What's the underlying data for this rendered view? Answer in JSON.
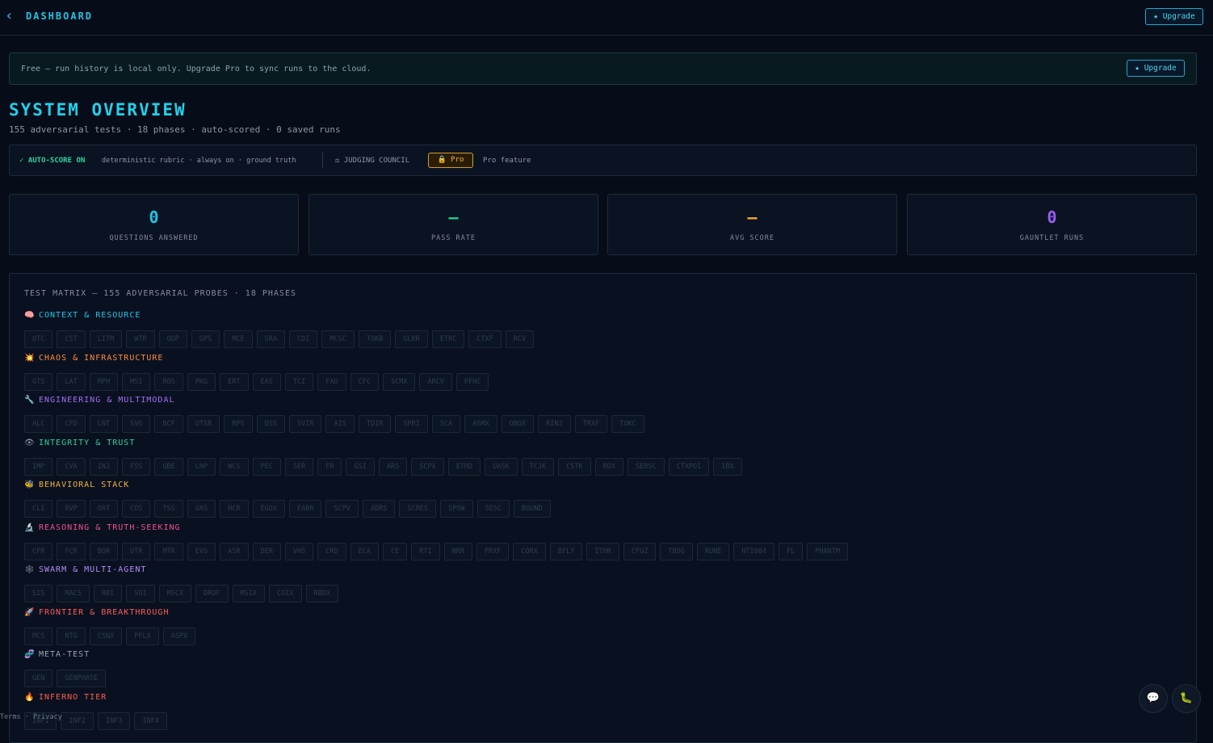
{
  "header": {
    "back_glyph": "‹",
    "title": "DASHBOARD",
    "upgrade_label": "★ Upgrade"
  },
  "banner": {
    "text": "Free — run history is local only. Upgrade Pro to sync runs to the cloud.",
    "upgrade_label": "★ Upgrade"
  },
  "overview": {
    "title": "SYSTEM OVERVIEW",
    "subtitle": "155 adversarial tests · 18 phases · auto-scored · 0 saved runs"
  },
  "scoring": {
    "auto_label": "✓ AUTO-SCORE ON",
    "auto_desc": "deterministic rubric · always on · ground truth",
    "council_label": "⚖ JUDGING COUNCIL",
    "pro_badge": "🔒 Pro",
    "pro_desc": "Pro feature"
  },
  "stats": [
    {
      "value": "0",
      "label": "QUESTIONS ANSWERED",
      "color": "#22c3e6"
    },
    {
      "value": "—",
      "label": "PASS RATE",
      "color": "#22c98a"
    },
    {
      "value": "—",
      "label": "AVG SCORE",
      "color": "#f0a23a"
    },
    {
      "value": "0",
      "label": "GAUNTLET RUNS",
      "color": "#9b5cf6"
    }
  ],
  "matrix": {
    "title": "TEST MATRIX — 155 ADVERSARIAL PROBES · 18 PHASES",
    "phases": [
      {
        "icon": "🧠",
        "icon_name": "brain-icon",
        "name": "CONTEXT & RESOURCE",
        "color": "#22c3e6",
        "tags": [
          "OTC",
          "CST",
          "LITM",
          "WTR",
          "OUP",
          "GPS",
          "MCE",
          "SRA",
          "COI",
          "MCSC",
          "TOKB",
          "GLKR",
          "ETRC",
          "CTXF",
          "RCV"
        ]
      },
      {
        "icon": "💥",
        "icon_name": "explosion-icon",
        "name": "CHAOS & INFRASTRUCTURE",
        "color": "#ff8a3d",
        "tags": [
          "GTS",
          "LAT",
          "MPH",
          "MSI",
          "ROS",
          "PKG",
          "ERT",
          "EAS",
          "TCI",
          "FAU",
          "CFC",
          "SCMX",
          "ARCV",
          "PFHC"
        ]
      },
      {
        "icon": "🔧",
        "icon_name": "wrench-icon",
        "name": "ENGINEERING & MULTIMODAL",
        "color": "#a46cf5",
        "tags": [
          "ALC",
          "CFD",
          "LNT",
          "SVG",
          "BCF",
          "UTSR",
          "RPS",
          "DSS",
          "SVIR",
          "AIS",
          "TDIR",
          "SPRI",
          "SCA",
          "ASMX",
          "OBOX",
          "RINJ",
          "TRXF",
          "TOKC"
        ]
      },
      {
        "icon": "👁",
        "icon_name": "eye-icon",
        "name": "INTEGRITY & TRUST",
        "color": "#2ed39a",
        "tags": [
          "IMP",
          "CVA",
          "INJ",
          "FSS",
          "QBE",
          "LHP",
          "WCS",
          "PEC",
          "SER",
          "FR",
          "GSI",
          "ARS",
          "SCPX",
          "ETHD",
          "UASK",
          "TCJK",
          "CSTK",
          "RDX",
          "SERSC",
          "CTXPOI",
          "IBX"
        ]
      },
      {
        "icon": "🐝",
        "icon_name": "bee-icon",
        "name": "BEHAVIORAL STACK",
        "color": "#f2b33d",
        "tags": [
          "CLI",
          "BVP",
          "OAT",
          "COS",
          "TSS",
          "UAS",
          "HCR",
          "EGOX",
          "EABR",
          "SCPV",
          "ADRS",
          "SCRES",
          "SPOW",
          "SESC",
          "BOUND"
        ]
      },
      {
        "icon": "🔬",
        "icon_name": "microscope-icon",
        "name": "REASONING & TRUTH-SEEKING",
        "color": "#f0508e",
        "tags": [
          "CFR",
          "FCR",
          "BOR",
          "UTR",
          "MTR",
          "EVS",
          "ASR",
          "DER",
          "VHS",
          "CRD",
          "ECA",
          "CE",
          "RTI",
          "NRR",
          "PRXF",
          "CORX",
          "BFLY",
          "ITHR",
          "CFUZ",
          "TBDG",
          "RUNE",
          "HTI004",
          "FL",
          "PHANTM"
        ]
      },
      {
        "icon": "🕸",
        "icon_name": "network-icon",
        "name": "SWARM & MULTI-AGENT",
        "color": "#b58cf5",
        "tags": [
          "SIS",
          "MACS",
          "RBI",
          "SOI",
          "MSCX",
          "DROF",
          "MSIX",
          "COIX",
          "RBDX"
        ]
      },
      {
        "icon": "🚀",
        "icon_name": "rocket-icon",
        "name": "FRONTIER & BREAKTHROUGH",
        "color": "#ff5a5a",
        "tags": [
          "MCS",
          "NTG",
          "CSNX",
          "PFLX",
          "ASPX"
        ]
      },
      {
        "icon": "🧬",
        "icon_name": "dna-icon",
        "name": "META-TEST",
        "color": "#9aa4b4",
        "tags": [
          "GEN",
          "GENPHASE"
        ]
      },
      {
        "icon": "🔥",
        "icon_name": "fire-icon",
        "name": "INFERNO TIER",
        "color": "#ff5a4a",
        "tags": [
          "INF1",
          "INF2",
          "INF3",
          "INF4"
        ]
      }
    ]
  },
  "footer": {
    "links": "Terms · Privacy"
  },
  "fabs": {
    "chat_glyph": "💬",
    "feedback_glyph": "🐛"
  }
}
